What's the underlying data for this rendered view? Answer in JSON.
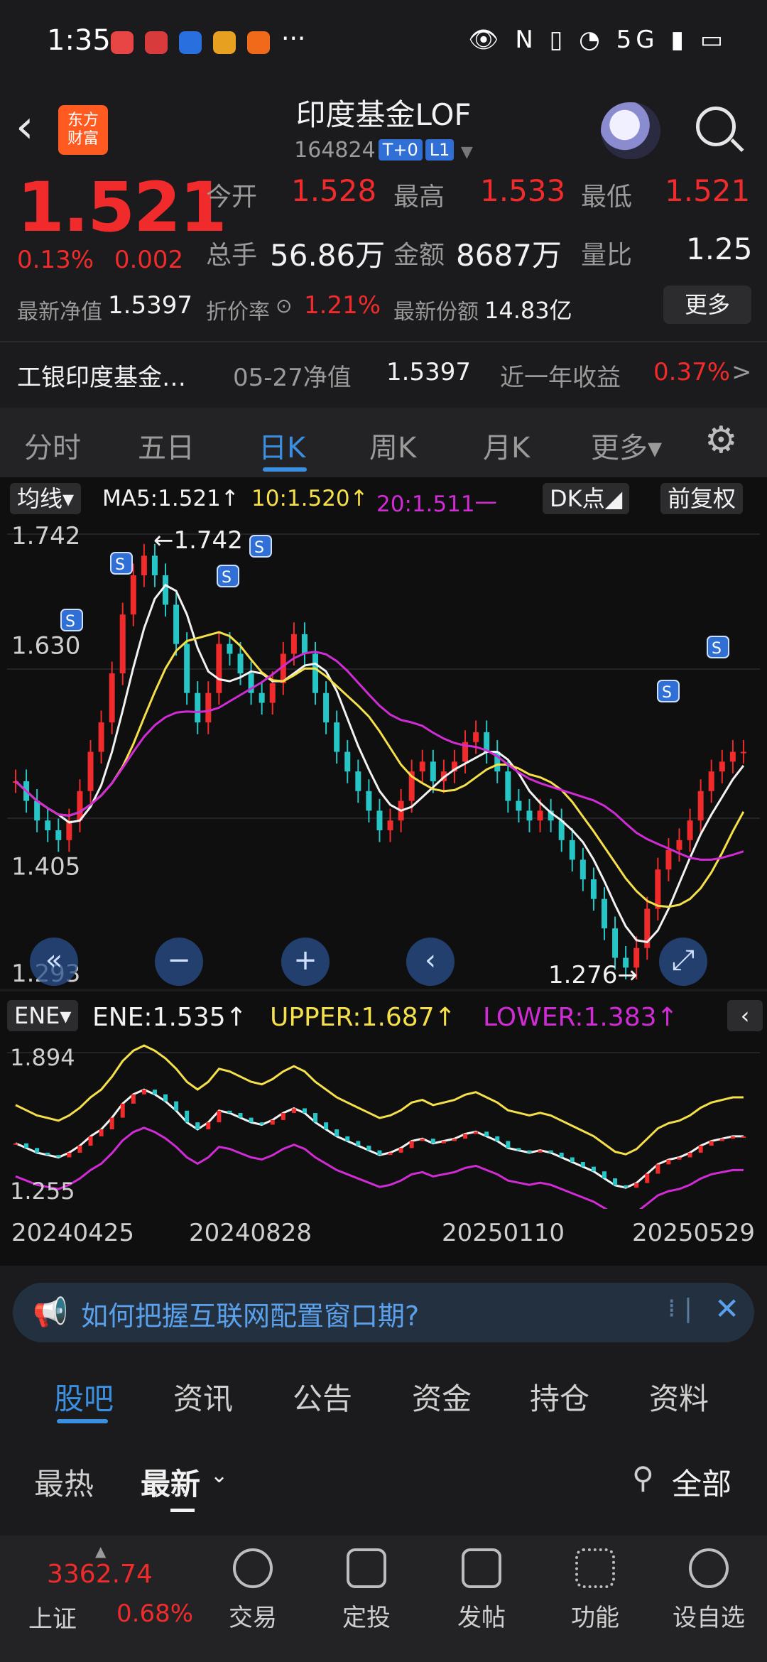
{
  "status": {
    "time": "1:35",
    "right_icons": "👁 N ▯ ◔ 5G ▮ ▭"
  },
  "header": {
    "title": "印度基金LOF",
    "code": "164824",
    "tag1": "T+0",
    "tag2": "L1",
    "logo_text_1": "东方",
    "logo_text_2": "财富"
  },
  "quote": {
    "price": "1.521",
    "change_pct": "0.13%",
    "change_abs": "0.002",
    "open_label": "今开",
    "open": "1.528",
    "high_label": "最高",
    "high": "1.533",
    "low_label": "最低",
    "low": "1.521",
    "volume_label": "总手",
    "volume": "56.86万",
    "amount_label": "金额",
    "amount": "8687万",
    "ratio_label": "量比",
    "ratio": "1.25",
    "nav_label": "最新净值",
    "nav": "1.5397",
    "discount_label": "折价率",
    "discount": "1.21%",
    "shares_label": "最新份额",
    "shares": "14.83亿",
    "more": "更多"
  },
  "fund_row": {
    "name": "工银印度基金…",
    "nav_date_label": "05-27净值",
    "nav_value": "1.5397",
    "year_label": "近一年收益",
    "year_value": "0.37%",
    "arrow": ">"
  },
  "period_tabs": [
    "分时",
    "五日",
    "日K",
    "周K",
    "月K",
    "更多▾"
  ],
  "chart_toolbar": {
    "ma_select": "均线▾",
    "ma5": "MA5:1.521↑",
    "ma10": "10:1.520↑",
    "ma20": "20:1.511一",
    "dk": "DK点◢",
    "adjust": "前复权"
  },
  "chart_data": {
    "type": "candlestick",
    "y_ticks": [
      "1.742",
      "1.630",
      "1.405",
      "1.293"
    ],
    "max_marker": "←1.742",
    "min_marker": "1.276→",
    "ylim": [
      1.293,
      1.742
    ],
    "close": [
      1.49,
      1.47,
      1.45,
      1.44,
      1.43,
      1.45,
      1.48,
      1.52,
      1.55,
      1.6,
      1.66,
      1.7,
      1.72,
      1.7,
      1.67,
      1.63,
      1.58,
      1.55,
      1.58,
      1.63,
      1.62,
      1.6,
      1.58,
      1.57,
      1.59,
      1.62,
      1.64,
      1.62,
      1.58,
      1.55,
      1.52,
      1.5,
      1.48,
      1.46,
      1.44,
      1.45,
      1.47,
      1.5,
      1.51,
      1.49,
      1.5,
      1.51,
      1.53,
      1.54,
      1.52,
      1.5,
      1.47,
      1.46,
      1.45,
      1.46,
      1.45,
      1.43,
      1.41,
      1.39,
      1.37,
      1.34,
      1.31,
      1.3,
      1.32,
      1.36,
      1.4,
      1.42,
      1.43,
      1.45,
      1.48,
      1.5,
      1.51,
      1.52,
      1.52
    ]
  },
  "ene": {
    "select": "ENE▾",
    "ene": "ENE:1.535↑",
    "upper": "UPPER:1.687↑",
    "lower": "LOWER:1.383↑",
    "y_top": "1.894",
    "y_bottom": "1.255"
  },
  "dates": [
    "20240425",
    "20240828",
    "20250110",
    "20250529"
  ],
  "banner": {
    "text": "如何把握互联网配置窗口期?"
  },
  "guba_tabs": [
    "股吧",
    "资讯",
    "公告",
    "资金",
    "持仓",
    "资料"
  ],
  "sort": {
    "hot": "最热",
    "latest": "最新",
    "filter": "全部"
  },
  "index": {
    "name": "上证",
    "value": "3362.74",
    "pct": "0.68%"
  },
  "bottom_nav": [
    "交易",
    "定投",
    "发帖",
    "功能",
    "设自选"
  ],
  "colors": {
    "up": "#f12b2b",
    "accent": "#3b8fe0",
    "ma10": "#f5e04a",
    "ma20": "#d12bd6"
  }
}
